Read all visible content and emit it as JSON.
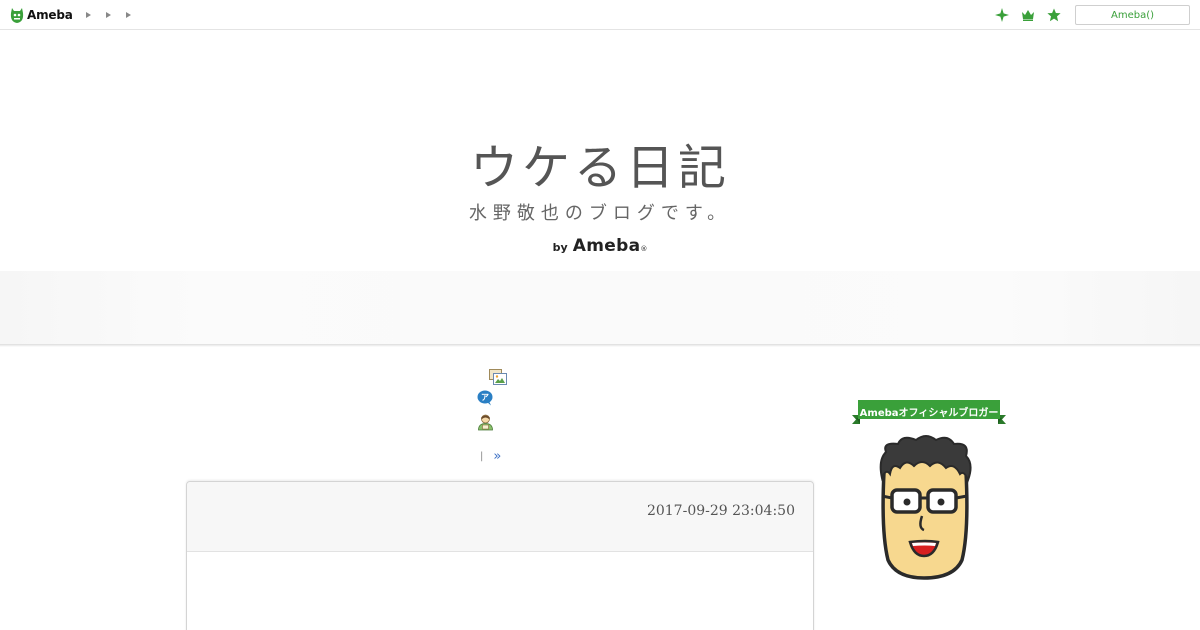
{
  "topbar": {
    "logo_text": "Ameba",
    "breadcrumb_count": 3,
    "icons": [
      "sparkle-icon",
      "crown-icon",
      "star-icon"
    ],
    "login_label": "Ameba()",
    "accent_color": "#3aa03a"
  },
  "header": {
    "title": "ウケる日記",
    "subtitle": "水野敬也のブログです。",
    "by_label": "by",
    "brand": "Ameba",
    "brand_mark": "®"
  },
  "nav": {
    "icons": [
      "image-gallery-icon",
      "blog-balloon-icon",
      "reader-icon"
    ],
    "separator": "|",
    "next_label": "»"
  },
  "article": {
    "date": "2017-09-29 23:04:50"
  },
  "sidebar": {
    "badge_label": "Amebaオフィシャルブロガー",
    "badge_color": "#3aa03a",
    "avatar_icon": "blogger-avatar-icon"
  }
}
